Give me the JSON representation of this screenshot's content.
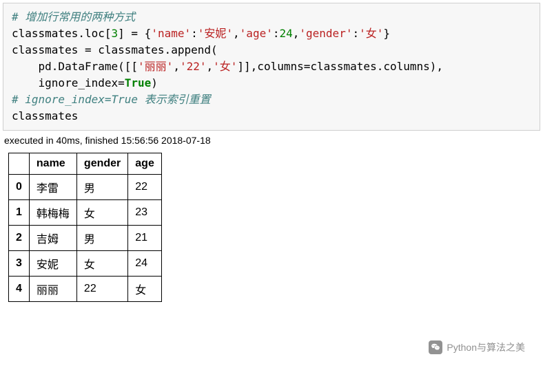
{
  "code": {
    "c1": "# 增加行常用的两种方式",
    "l2a": "classmates.loc[",
    "l2num": "3",
    "l2b": "] = {",
    "l2k1": "'name'",
    "l2v1": "'安妮'",
    "l2k2": "'age'",
    "l2v2": "24",
    "l2k3": "'gender'",
    "l2v3": "'女'",
    "l2end": "}",
    "l3": "classmates = classmates.append(",
    "l4a": "    pd.DataFrame([[",
    "l4v1": "'丽丽'",
    "l4v2": "'22'",
    "l4v3": "'女'",
    "l4b": "]],columns=classmates.columns),",
    "l5a": "    ignore_index=",
    "l5kw": "True",
    "l5b": ")",
    "c2": "# ignore_index=True 表示索引重置",
    "l7": "classmates"
  },
  "exec_info": "executed in 40ms, finished 15:56:56 2018-07-18",
  "table": {
    "headers": [
      "",
      "name",
      "gender",
      "age"
    ],
    "rows": [
      {
        "idx": "0",
        "name": "李雷",
        "gender": "男",
        "age": "22"
      },
      {
        "idx": "1",
        "name": "韩梅梅",
        "gender": "女",
        "age": "23"
      },
      {
        "idx": "2",
        "name": "吉姆",
        "gender": "男",
        "age": "21"
      },
      {
        "idx": "3",
        "name": "安妮",
        "gender": "女",
        "age": "24"
      },
      {
        "idx": "4",
        "name": "丽丽",
        "gender": "22",
        "age": "女"
      }
    ]
  },
  "watermark": "Python与算法之美"
}
